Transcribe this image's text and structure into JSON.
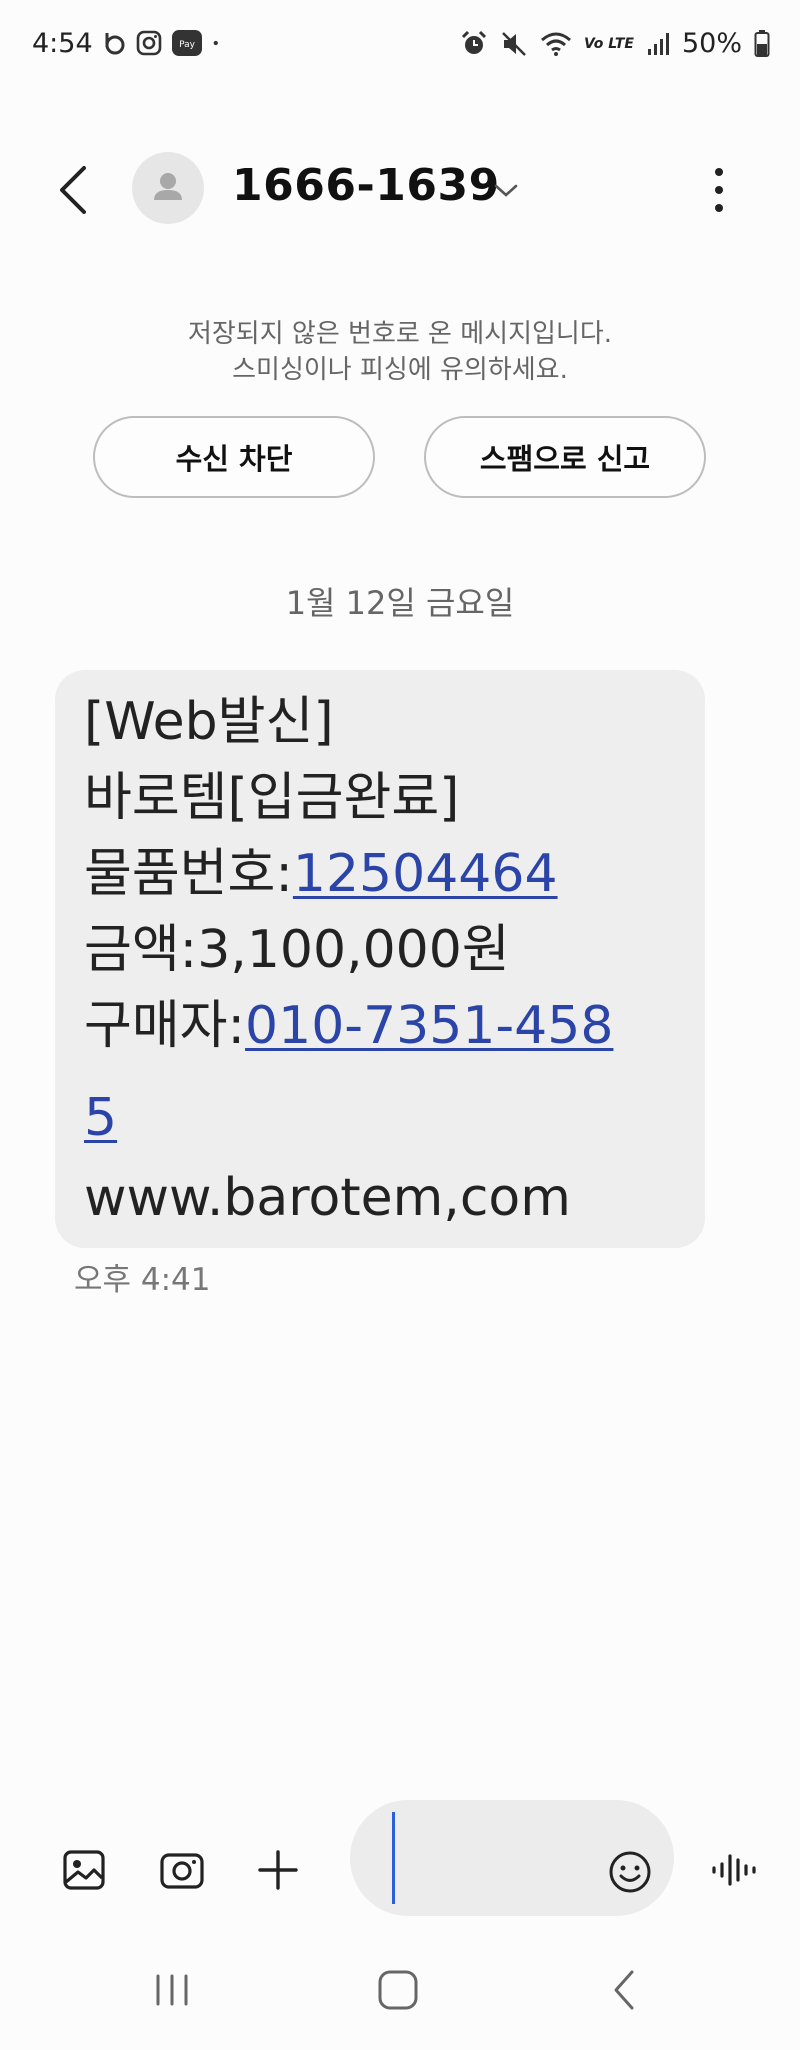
{
  "status_bar": {
    "time": "4:54",
    "left_icons": [
      "b-icon",
      "instagram-icon",
      "pay-icon",
      "dot-icon"
    ],
    "pay_label": "Pay",
    "volte_label": "Vo LTE",
    "battery": "50%"
  },
  "header": {
    "contact": "1666-1639"
  },
  "warning": {
    "line1": "저장되지 않은 번호로 온 메시지입니다.",
    "line2": "스미싱이나 피싱에 유의하세요.",
    "block_label": "수신 차단",
    "spam_label": "스팸으로 신고"
  },
  "conversation": {
    "date": "1월 12일 금요일",
    "message": {
      "line1": "[Web발신]",
      "line2": "바로템[입금완료]",
      "line3_prefix": "물품번호:",
      "line3_link": "12504464",
      "line4": "금액:3,100,000원",
      "line5_prefix": "구매자:",
      "line5_link": "010-7351-458",
      "line6_link": "5",
      "line7": "www.barotem,com",
      "time": "오후 4:41"
    }
  },
  "colors": {
    "link": "#2b44a8",
    "bubble": "#eeeeee",
    "cursor": "#2b60d8"
  }
}
